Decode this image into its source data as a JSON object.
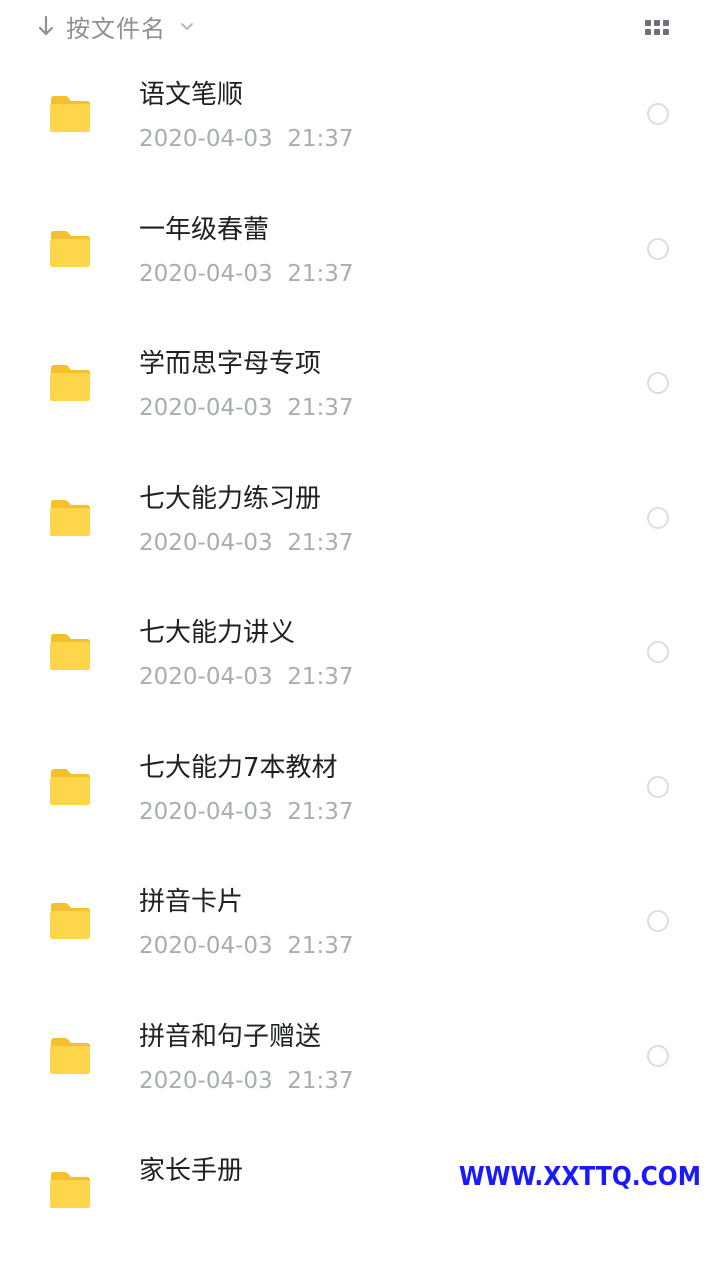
{
  "sort": {
    "label": "按文件名",
    "arrow_icon": "arrow-down-icon",
    "chevron_icon": "chevron-down-icon"
  },
  "view_toggle_icon": "grid-view-icon",
  "folder_color": "#FFD54A",
  "files": [
    {
      "name": "语文笔顺",
      "date": "2020-04-03  21:37"
    },
    {
      "name": "一年级春蕾",
      "date": "2020-04-03  21:37"
    },
    {
      "name": "学而思字母专项",
      "date": "2020-04-03  21:37"
    },
    {
      "name": "七大能力练习册",
      "date": "2020-04-03  21:37"
    },
    {
      "name": "七大能力讲义",
      "date": "2020-04-03  21:37"
    },
    {
      "name": "七大能力7本教材",
      "date": "2020-04-03  21:37"
    },
    {
      "name": "拼音卡片",
      "date": "2020-04-03  21:37"
    },
    {
      "name": "拼音和句子赠送",
      "date": "2020-04-03  21:37"
    },
    {
      "name": "家长手册",
      "date": ""
    }
  ],
  "watermark": "WWW.XXTTQ.COM"
}
